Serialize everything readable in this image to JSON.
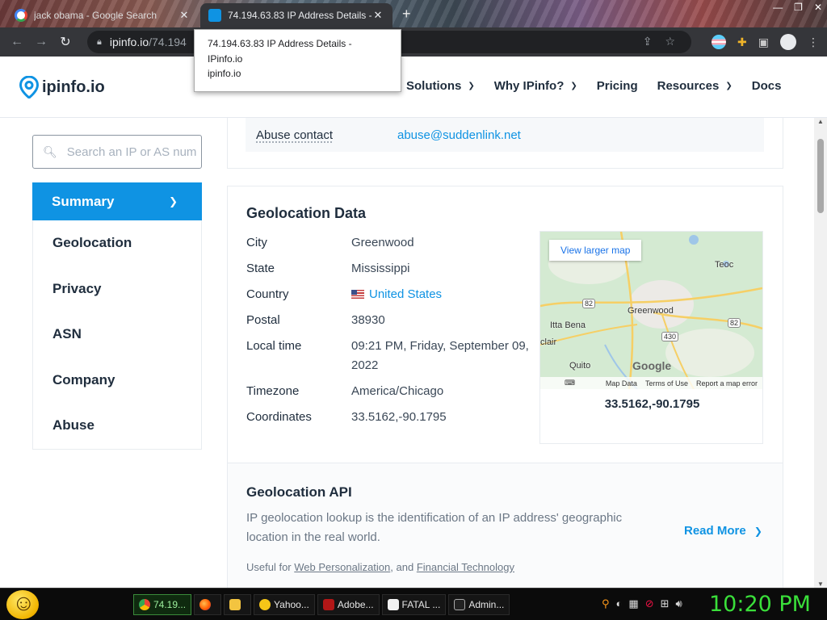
{
  "browser": {
    "tabs": [
      {
        "title": "jack obama - Google Search",
        "active": false
      },
      {
        "title": "74.194.63.83 IP Address Details -",
        "active": true
      }
    ],
    "url_host": "ipinfo.io",
    "url_path": "/74.194"
  },
  "tooltip": {
    "title": "74.194.63.83 IP Address Details - IPinfo.io",
    "host": "ipinfo.io"
  },
  "header": {
    "logo": "ipinfo.io",
    "nav": [
      {
        "label": "Solutions",
        "dropdown": true
      },
      {
        "label": "Why IPinfo?",
        "dropdown": true
      },
      {
        "label": "Pricing",
        "dropdown": false
      },
      {
        "label": "Resources",
        "dropdown": true
      },
      {
        "label": "Docs",
        "dropdown": false
      }
    ]
  },
  "sidebar": {
    "search_placeholder": "Search an IP or AS number",
    "items": [
      "Summary",
      "Geolocation",
      "Privacy",
      "ASN",
      "Company",
      "Abuse"
    ],
    "active_item": "Summary"
  },
  "abuse": {
    "label": "Abuse contact",
    "value": "abuse@suddenlink.net"
  },
  "geolocation": {
    "title": "Geolocation Data",
    "rows": [
      {
        "key": "City",
        "value": "Greenwood"
      },
      {
        "key": "State",
        "value": "Mississippi"
      },
      {
        "key": "Country",
        "value": "United States"
      },
      {
        "key": "Postal",
        "value": "38930"
      },
      {
        "key": "Local time",
        "value": "09:21 PM, Friday, September 09, 2022"
      },
      {
        "key": "Timezone",
        "value": "America/Chicago"
      },
      {
        "key": "Coordinates",
        "value": "33.5162,-90.1795"
      }
    ],
    "map": {
      "button": "View larger map",
      "labels": [
        "Teoc",
        "Greenwood",
        "Itta Bena",
        "clair",
        "Quito"
      ],
      "routes": [
        "82",
        "430",
        "82"
      ],
      "brand": "Google",
      "footer": [
        "Map Data",
        "Terms of Use",
        "Report a map error"
      ],
      "coords": "33.5162,-90.1795"
    }
  },
  "api": {
    "title": "Geolocation API",
    "description": "IP geolocation lookup is the identification of an IP address' geographic location in the real world.",
    "read_more": "Read More",
    "useful_prefix": "Useful for",
    "useful_link1": "Web Personalization",
    "useful_mid": ", and",
    "useful_link2": "Financial Technology"
  },
  "taskbar": {
    "tasks": [
      "74.19...",
      "",
      "",
      "Yahoo...",
      "Adobe...",
      "FATAL ...",
      "Admin..."
    ],
    "clock": "10:20 PM"
  },
  "colors": {
    "accent": "#0f93e3",
    "text": "#1f2d3d",
    "clock": "#3adf3a"
  }
}
